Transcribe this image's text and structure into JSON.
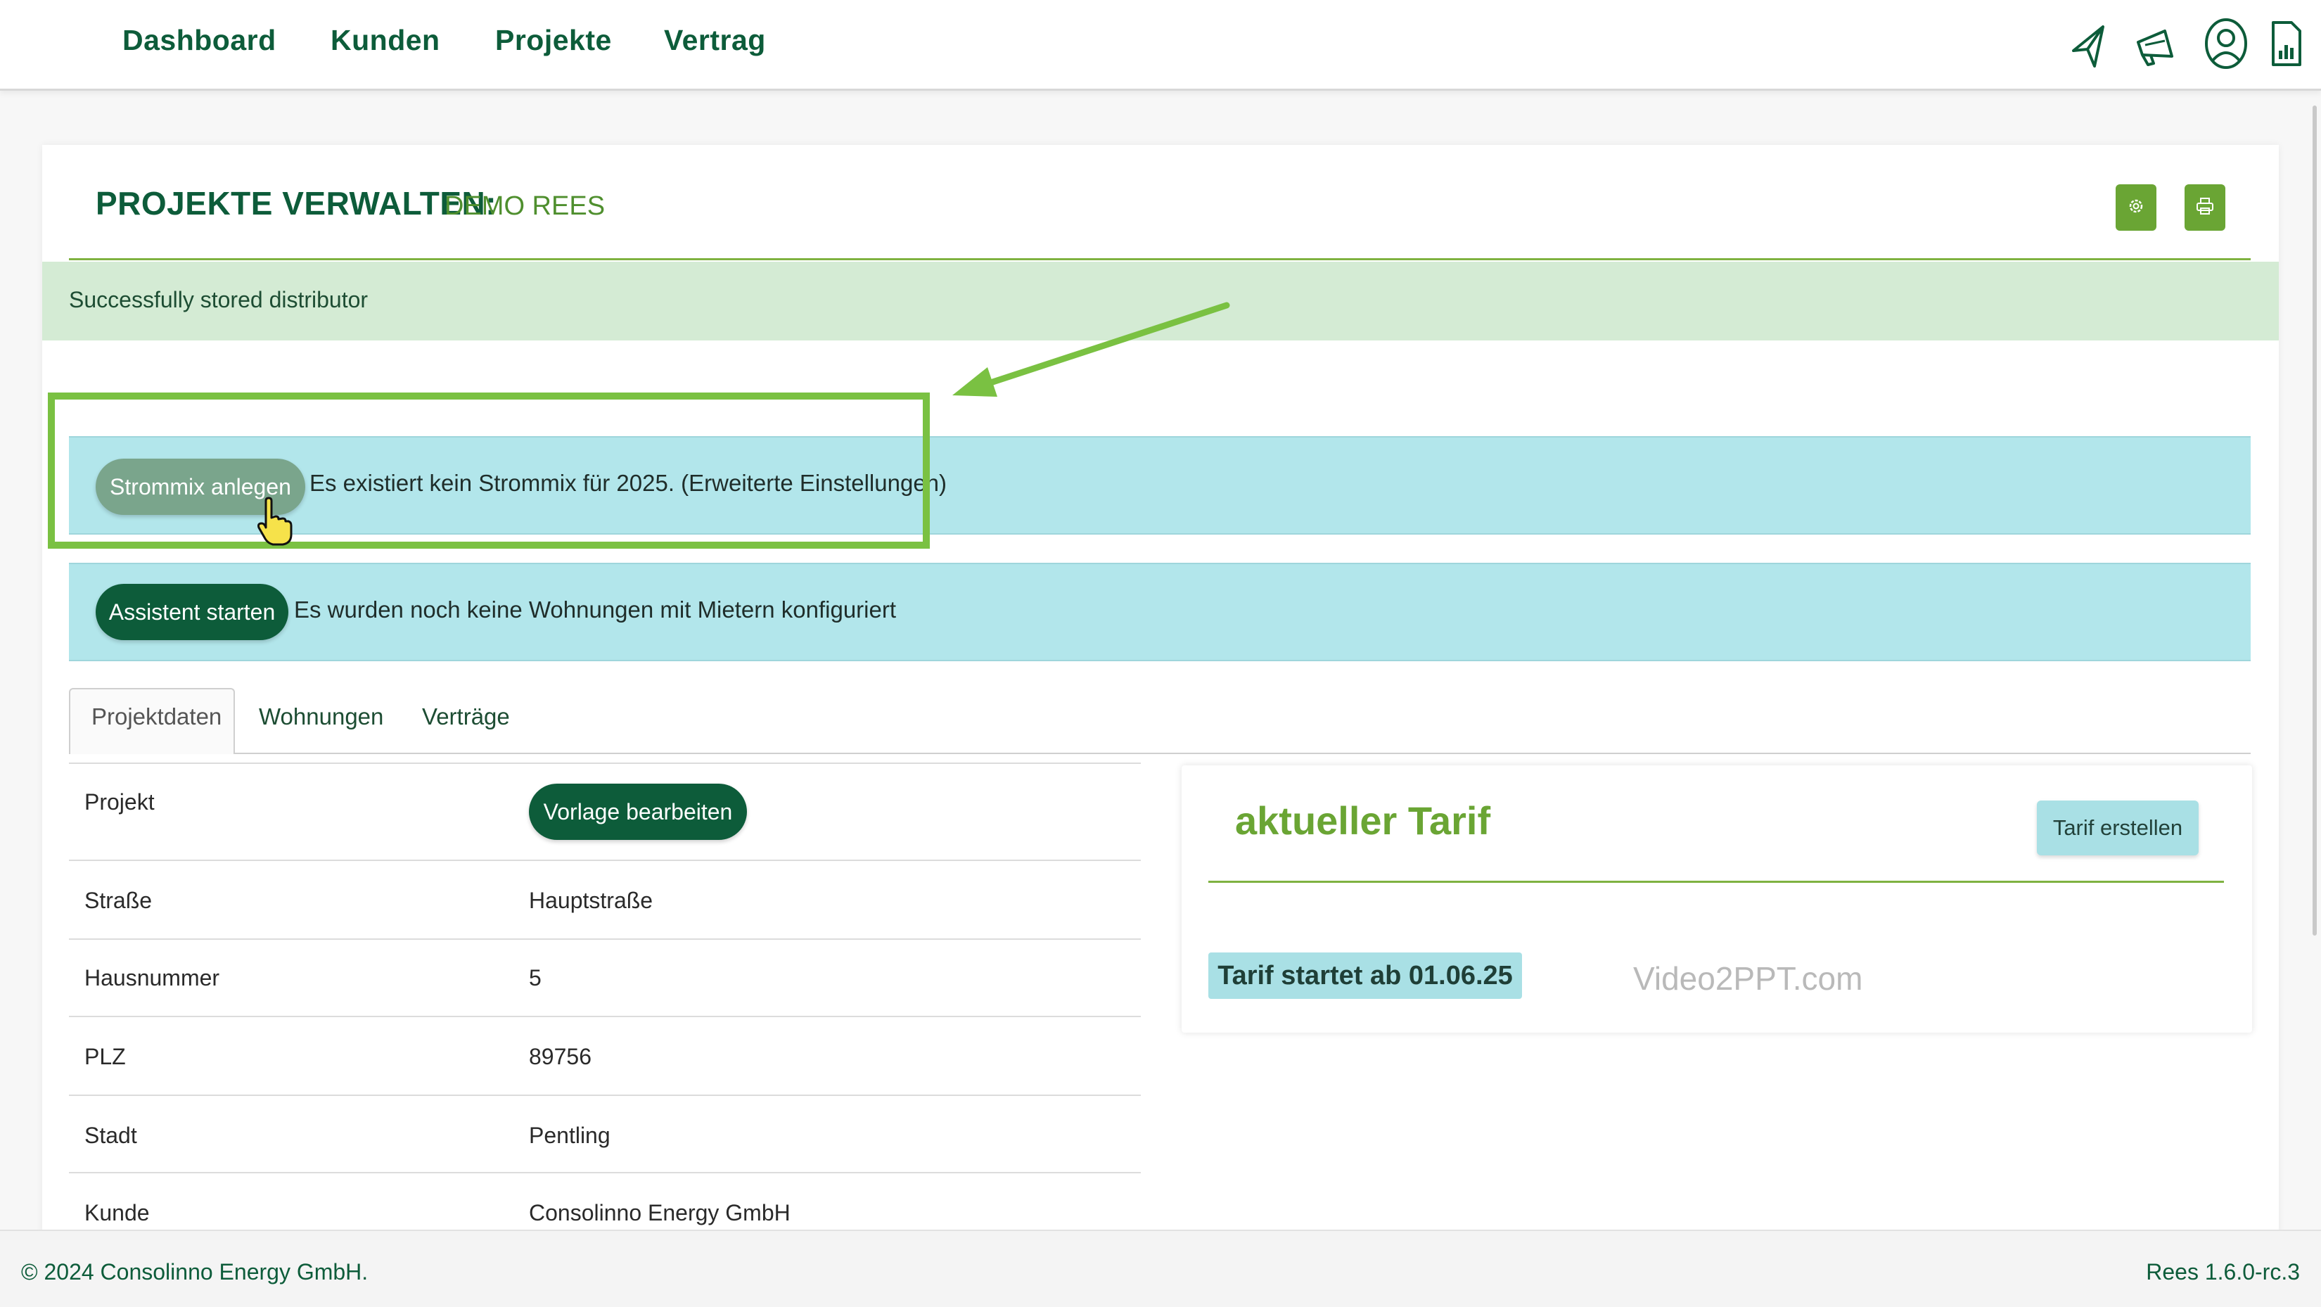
{
  "nav": {
    "items": [
      "Dashboard",
      "Kunden",
      "Projekte",
      "Vertrag"
    ]
  },
  "toolbar_icons": [
    "paper-plane-icon",
    "megaphone-icon",
    "user-icon",
    "document-chart-icon"
  ],
  "page": {
    "title": "PROJEKTE VERWALTEN:",
    "subtitle": "DEMO REES",
    "settings_icon": "gear-icon",
    "print_icon": "printer-icon"
  },
  "alert": {
    "success": "Successfully stored distributor"
  },
  "notices": {
    "strommix_button": "Strommix anlegen",
    "strommix_text": "Es existiert kein Strommix für 2025. (Erweiterte Einstellungen)",
    "assistant_button": "Assistent starten",
    "assistant_text": "Es wurden noch keine Wohnungen mit Mietern konfiguriert"
  },
  "tabs": [
    "Projektdaten",
    "Wohnungen",
    "Verträge"
  ],
  "project_table": {
    "rows": [
      {
        "label": "Projekt",
        "value": "Vorlage bearbeiten"
      },
      {
        "label": "Straße",
        "value": "Hauptstraße"
      },
      {
        "label": "Hausnummer",
        "value": "5"
      },
      {
        "label": "PLZ",
        "value": "89756"
      },
      {
        "label": "Stadt",
        "value": "Pentling"
      },
      {
        "label": "Kunde",
        "value": "Consolinno Energy GmbH"
      }
    ]
  },
  "tarif": {
    "title": "aktueller Tarif",
    "create_button": "Tarif erstellen",
    "start_badge": "Tarif startet ab 01.06.25",
    "watermark": "Video2PPT.com"
  },
  "footer": {
    "copyright": "© 2024 Consolinno Energy GmbH.",
    "version": "Rees 1.6.0-rc.3"
  },
  "colors": {
    "brand_dark": "#0d5c3a",
    "brand_green": "#6aa534",
    "info_bg": "#b2e6eb",
    "success_bg": "#d4ebd4",
    "highlight": "#7ac142"
  }
}
